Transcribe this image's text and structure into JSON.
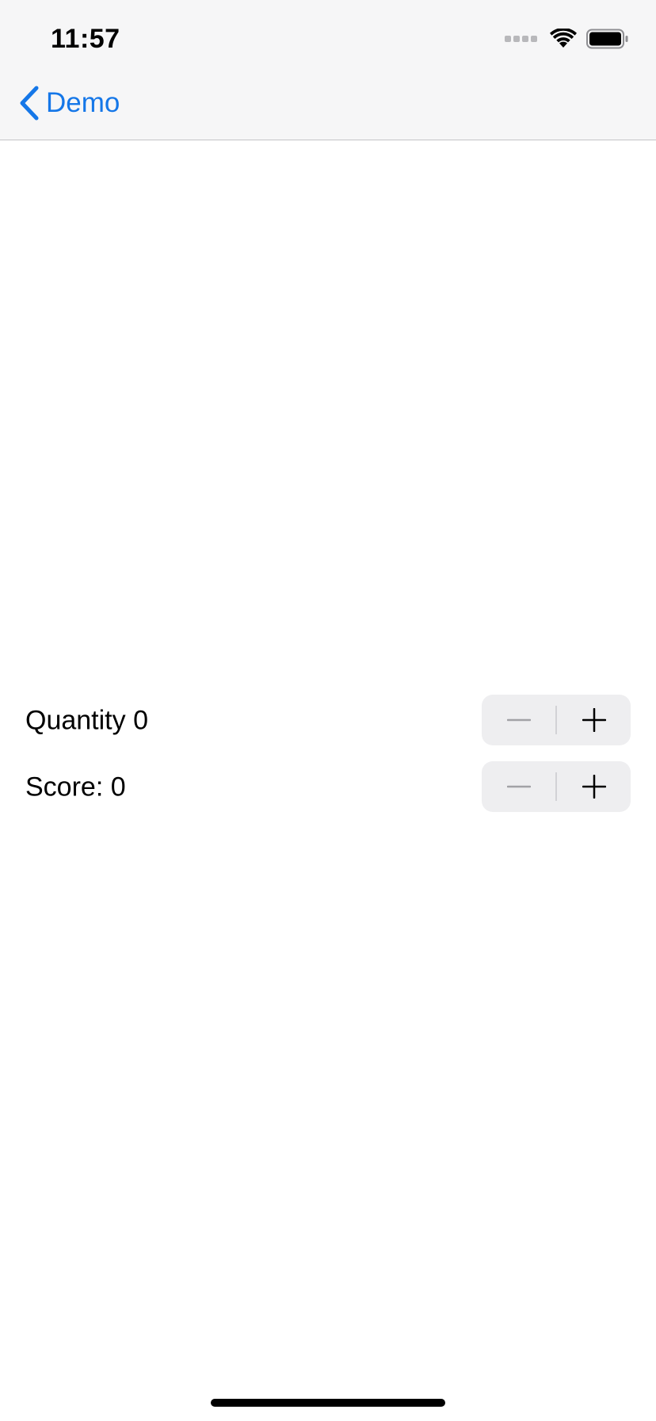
{
  "status_bar": {
    "time": "11:57",
    "icons": [
      "signal-dots-icon",
      "wifi-icon",
      "battery-icon"
    ]
  },
  "nav": {
    "back_label": "Demo",
    "accent_color": "#1577e8"
  },
  "rows": [
    {
      "label": "Quantity 0",
      "value": 0,
      "decrement_icon": "minus-icon",
      "increment_icon": "plus-icon"
    },
    {
      "label": "Score: 0",
      "value": 0,
      "decrement_icon": "minus-icon",
      "increment_icon": "plus-icon"
    }
  ]
}
